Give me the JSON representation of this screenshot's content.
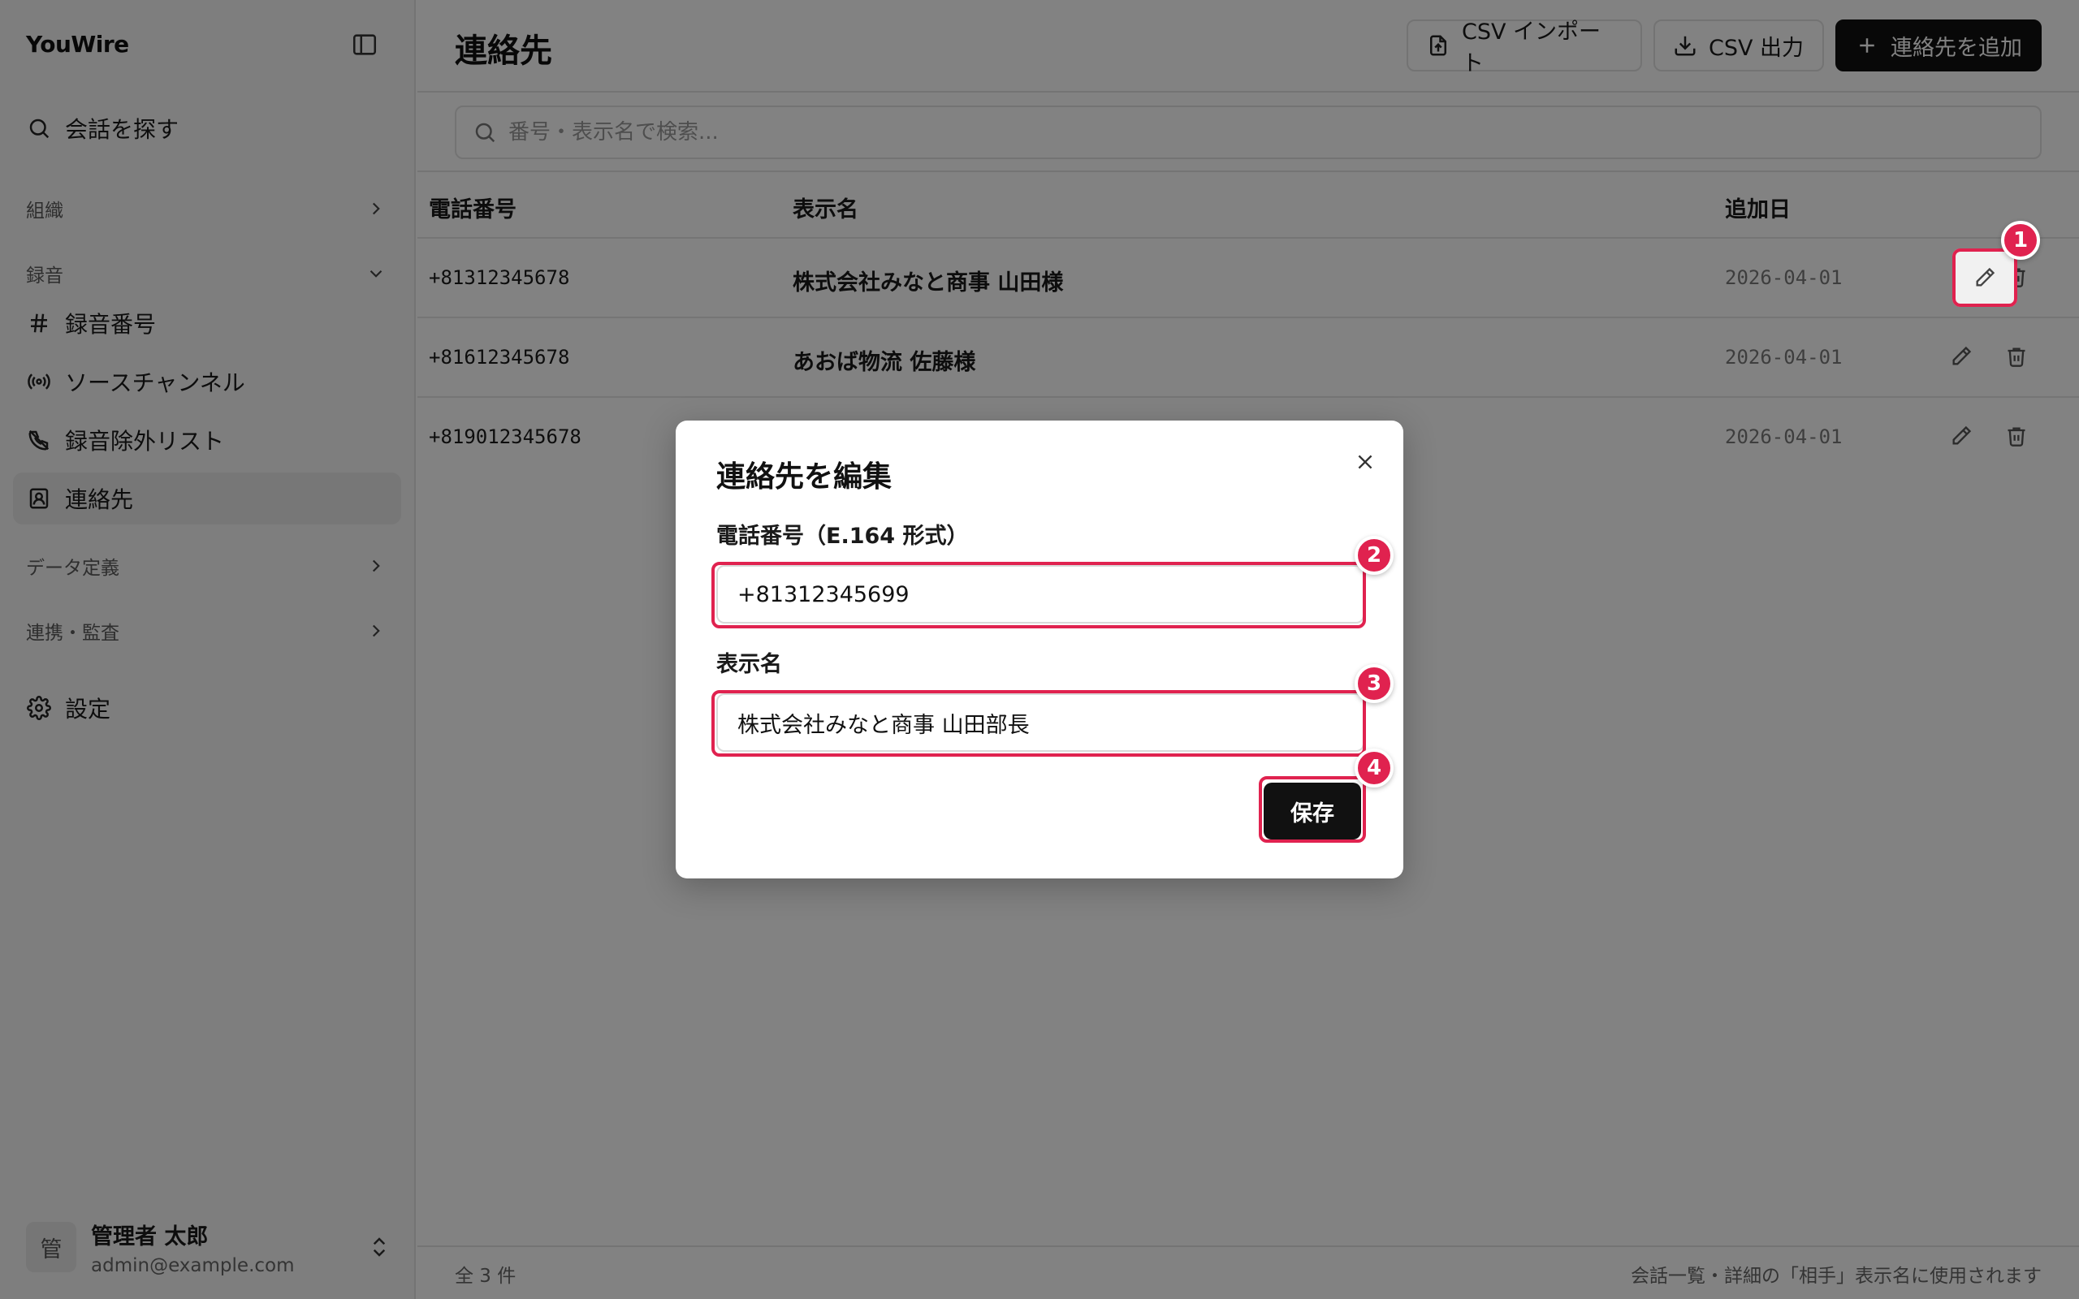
{
  "app": {
    "brand": "YouWire"
  },
  "sidebar": {
    "search_label": "会話を探す",
    "group_org": "組織",
    "group_recording": "録音",
    "items": [
      {
        "label": "録音番号",
        "icon": "hash-icon"
      },
      {
        "label": "ソースチャンネル",
        "icon": "radio-icon"
      },
      {
        "label": "録音除外リスト",
        "icon": "phone-off-icon"
      },
      {
        "label": "連絡先",
        "icon": "contact-icon",
        "active": true
      }
    ],
    "group_data": "データ定義",
    "group_integration": "連携・監査",
    "settings_label": "設定",
    "user": {
      "avatar": "管",
      "name": "管理者 太郎",
      "email": "admin@example.com"
    }
  },
  "header": {
    "title": "連絡先",
    "import_label": "CSV インポート",
    "export_label": "CSV 出力",
    "add_label": "連絡先を追加"
  },
  "search": {
    "placeholder": "番号・表示名で検索..."
  },
  "table": {
    "columns": [
      "電話番号",
      "表示名",
      "追加日"
    ],
    "rows": [
      {
        "phone": "+81312345678",
        "name": "株式会社みなと商事 山田様",
        "date": "2026-04-01"
      },
      {
        "phone": "+81612345678",
        "name": "あおば物流 佐藤様",
        "date": "2026-04-01"
      },
      {
        "phone": "+819012345678",
        "name": "",
        "date": "2026-04-01"
      }
    ]
  },
  "footer": {
    "count": "全 3 件",
    "note": "会話一覧・詳細の「相手」表示名に使用されます"
  },
  "modal": {
    "title": "連絡先を編集",
    "phone_label": "電話番号（E.164 形式）",
    "phone_value": "+81312345699",
    "name_label": "表示名",
    "name_value": "株式会社みなと商事 山田部長",
    "save_label": "保存"
  },
  "markers": [
    "1",
    "2",
    "3",
    "4"
  ],
  "colors": {
    "accent": "#e0224f",
    "primary": "#111111"
  }
}
